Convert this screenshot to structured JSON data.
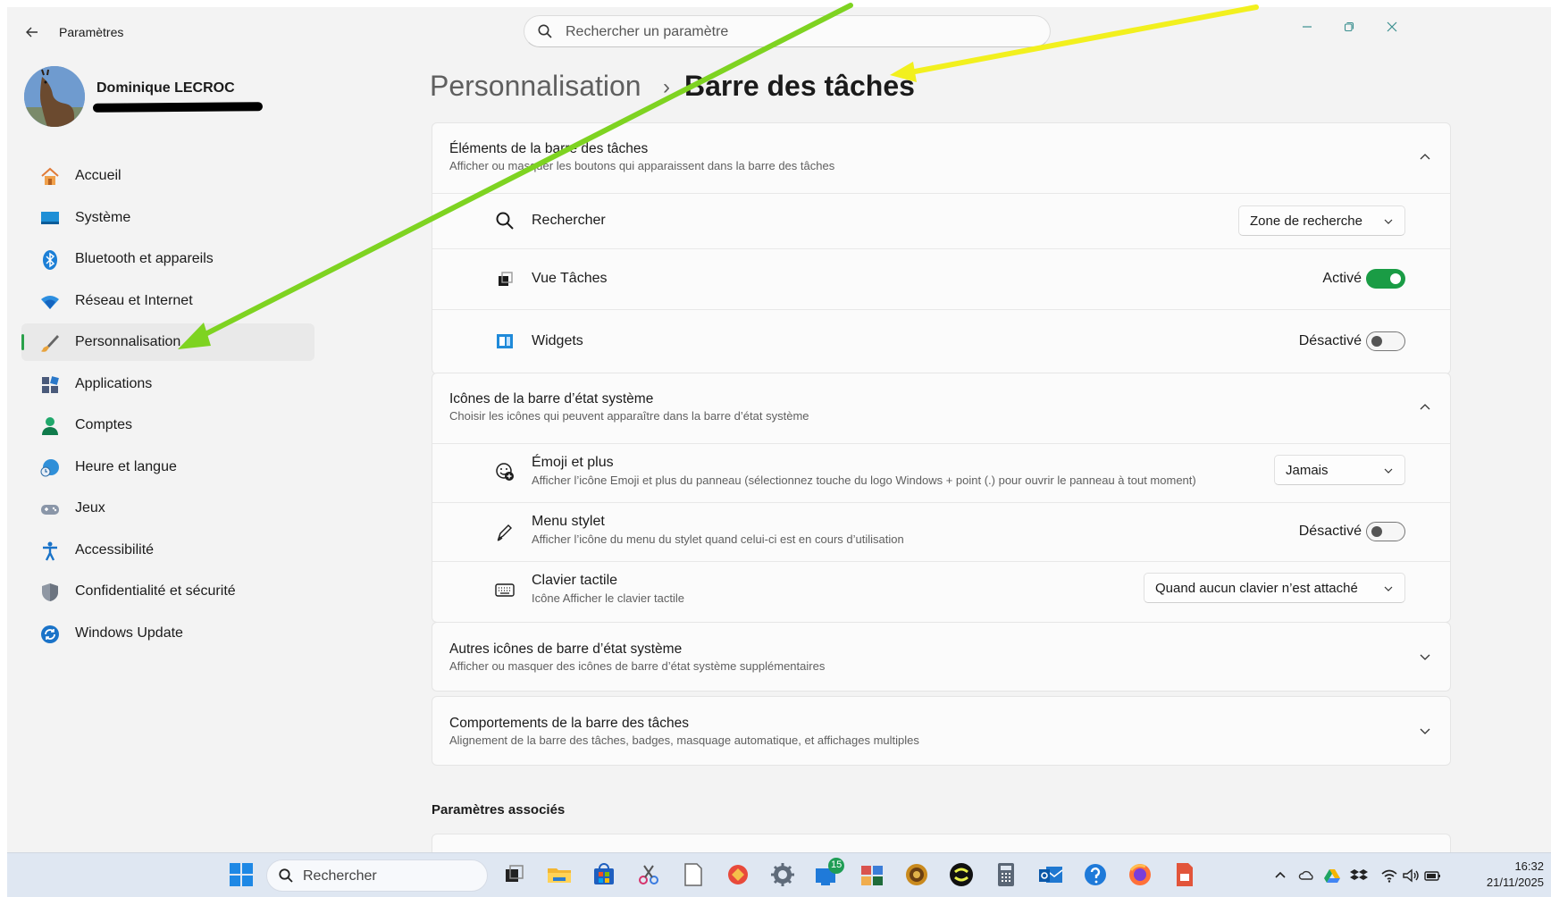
{
  "window": {
    "back_icon": "arrow-left-icon",
    "title": "Paramètres",
    "controls": [
      "minimize-icon",
      "restore-icon",
      "close-icon"
    ]
  },
  "search": {
    "placeholder": "Rechercher un paramètre"
  },
  "profile": {
    "name": "Dominique LECROC"
  },
  "sidebar": {
    "items": [
      {
        "label": "Accueil",
        "icon": "home-icon",
        "active": false
      },
      {
        "label": "Système",
        "icon": "monitor-icon",
        "active": false
      },
      {
        "label": "Bluetooth et appareils",
        "icon": "bluetooth-icon",
        "active": false
      },
      {
        "label": "Réseau et Internet",
        "icon": "wifi-icon",
        "active": false
      },
      {
        "label": "Personnalisation",
        "icon": "brush-icon",
        "active": true
      },
      {
        "label": "Applications",
        "icon": "apps-icon",
        "active": false
      },
      {
        "label": "Comptes",
        "icon": "person-icon",
        "active": false
      },
      {
        "label": "Heure et langue",
        "icon": "globe-clock-icon",
        "active": false
      },
      {
        "label": "Jeux",
        "icon": "gamepad-icon",
        "active": false
      },
      {
        "label": "Accessibilité",
        "icon": "accessibility-icon",
        "active": false
      },
      {
        "label": "Confidentialité et sécurité",
        "icon": "shield-icon",
        "active": false
      },
      {
        "label": "Windows Update",
        "icon": "update-icon",
        "active": false
      }
    ]
  },
  "header": {
    "parent": "Personnalisation",
    "separator": "›",
    "current": "Barre des tâches"
  },
  "sections": {
    "taskbar_items": {
      "title": "Éléments de la barre des tâches",
      "subtitle": "Afficher ou masquer les boutons qui apparaissent dans la barre des tâches",
      "expanded": true,
      "rows": {
        "search": {
          "label": "Rechercher",
          "value": "Zone de recherche"
        },
        "task_view": {
          "label": "Vue Tâches",
          "state": "Activé",
          "on": true
        },
        "widgets": {
          "label": "Widgets",
          "state": "Désactivé",
          "on": false
        }
      }
    },
    "system_tray": {
      "title": "Icônes de la barre d’état système",
      "subtitle": "Choisir les icônes qui peuvent apparaître dans la barre d’état système",
      "expanded": true,
      "rows": {
        "emoji": {
          "label": "Émoji et plus",
          "desc": "Afficher l’icône Emoji et plus du panneau (sélectionnez touche du logo Windows + point (.) pour ouvrir le panneau à tout moment)",
          "value": "Jamais"
        },
        "pen": {
          "label": "Menu stylet",
          "desc": "Afficher l’icône du menu du stylet quand celui-ci est en cours d’utilisation",
          "state": "Désactivé",
          "on": false
        },
        "keyboard": {
          "label": "Clavier tactile",
          "desc": "Icône Afficher le clavier tactile",
          "value": "Quand aucun clavier n’est attaché"
        }
      }
    },
    "other_tray": {
      "title": "Autres icônes de barre d’état système",
      "subtitle": "Afficher ou masquer des icônes de barre d’état système supplémentaires",
      "expanded": false
    },
    "behaviors": {
      "title": "Comportements de la barre des tâches",
      "subtitle": "Alignement de la barre des tâches, badges, masquage automatique, et affichages multiples",
      "expanded": false
    }
  },
  "associated": {
    "title": "Paramètres associés"
  },
  "taskbar": {
    "search_label": "Rechercher",
    "badge_count": "15",
    "time": "16:32",
    "date": "21/11/2025",
    "apps": [
      "windows-start-icon",
      "task-view-icon",
      "file-explorer-icon",
      "store-icon",
      "snipping-icon",
      "notepad-icon",
      "app-icon",
      "settings-icon",
      "remote-desktop-icon",
      "news-icon",
      "game-icon",
      "logo-icon",
      "calculator-icon",
      "outlook-icon",
      "help-icon",
      "firefox-icon",
      "presentation-icon"
    ]
  },
  "annotations": {
    "arrow_colors": [
      "#7ed321",
      "#f2f01e"
    ]
  }
}
